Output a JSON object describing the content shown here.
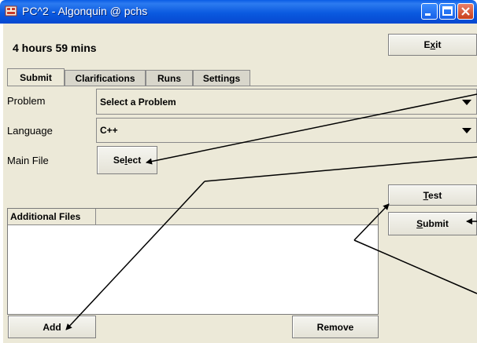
{
  "window": {
    "title": "PC^2 - Algonquin @ pchs",
    "controls": [
      "minimize-icon",
      "maximize-icon",
      "close-icon"
    ]
  },
  "header": {
    "time_remaining": "4 hours 59 mins",
    "exit_label_pre": "E",
    "exit_label_u": "x",
    "exit_label_post": "it"
  },
  "tabs": [
    {
      "label": "Submit",
      "active": true
    },
    {
      "label": "Clarifications",
      "active": false
    },
    {
      "label": "Runs",
      "active": false
    },
    {
      "label": "Settings",
      "active": false
    }
  ],
  "form": {
    "problem_label": "Problem",
    "problem_value": "Select a Problem",
    "language_label": "Language",
    "language_value": "C++",
    "main_file_label": "Main File",
    "select_pre": "Se",
    "select_u": "l",
    "select_post": "ect"
  },
  "buttons": {
    "test_pre": "",
    "test_u": "T",
    "test_post": "est",
    "submit_pre": "",
    "submit_u": "S",
    "submit_post": "ubmit",
    "add": "Add",
    "remove": "Remove"
  },
  "additional_files": {
    "column_header": "Additional Files",
    "rows": []
  },
  "colors": {
    "title_bar": "#0a5ae0",
    "panel": "#ece9d8",
    "close_button": "#c8401c"
  }
}
